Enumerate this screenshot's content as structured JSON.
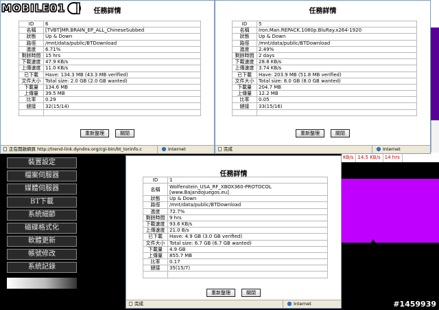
{
  "watermark": {
    "logo_text": "MOBILE01",
    "id_text": "#1459939"
  },
  "colors": {
    "purple": "#c000ff",
    "xp_status": "#ece9d8",
    "border": "#7f9db9"
  },
  "admin_menu": [
    "裝置設定",
    "檔案伺服器",
    "媒體伺服器",
    "BT下載",
    "系統細節",
    "磁碟格式化",
    "軟體更新",
    "帳號修改",
    "系統記錄"
  ],
  "right_page": {
    "cells": [
      "KB/s",
      "14.5 KB/s",
      "14 hrs"
    ]
  },
  "labels": {
    "title": "任務詳情",
    "keys": [
      "ID",
      "名稱",
      "狀態",
      "路徑",
      "進度",
      "剩餘時間",
      "下載速度",
      "上傳速度",
      "已下載",
      "文件大小",
      "下載量",
      "上傳量",
      "比率",
      "鏈接"
    ],
    "refresh_button": "重新整理",
    "close_button": "關閉",
    "internet": "Internet"
  },
  "windows": [
    {
      "values": [
        "6",
        "[TVBT]MR.BRAIN_EP_ALL_ChineseSubbed",
        "Up & Down",
        "/mnt/data/public/BTDownload",
        "6.71%",
        "15 hrs",
        "47.9 KB/s",
        "11.0 KB/s",
        "Have: 134.3 MB (43.3 MB verified)",
        "Total size: 2.0 GB (2.0 GB wanted)",
        "134.6 MB",
        "39.5 MB",
        "0.29",
        "32(15/14)"
      ],
      "status_text": "正在開啟網頁 http://trend-link.dyndns.org/cgi-bin/bt_torinfo.c"
    },
    {
      "values": [
        "5",
        "Iron.Man.REPACK.1080p.BluRay.x264-1920",
        "Up & Down",
        "/mnt/data/public/BTDownload",
        "2.49%",
        "2 days",
        "28.8 KB/s",
        "3.74 KB/s",
        "Have: 203.9 MB (51.8 MB verified)",
        "Total size: 8.0 GB (8.0 GB wanted)",
        "204.7 MB",
        "12.2 MB",
        "0.05",
        "33(15/16)"
      ],
      "status_text": "完成"
    },
    {
      "values": [
        "1",
        "Wolfenstein_USA_RF_XBOX360-PROTOCOL",
        "Up & Down",
        "/mnt/data/public/BTDownload",
        "72.7%",
        "9 hrs",
        "93.6 KB/s",
        "21.0 B/s",
        "Have: 4.9 GB (3.0 GB verified)",
        "Total size: 6.7 GB (6.7 GB wanted)",
        "4.9 GB",
        "855.7 MB",
        "0.17",
        "35(15/7)"
      ],
      "name_line2": "[www.BajandoJuegos.eu]",
      "status_text": "完成"
    }
  ]
}
